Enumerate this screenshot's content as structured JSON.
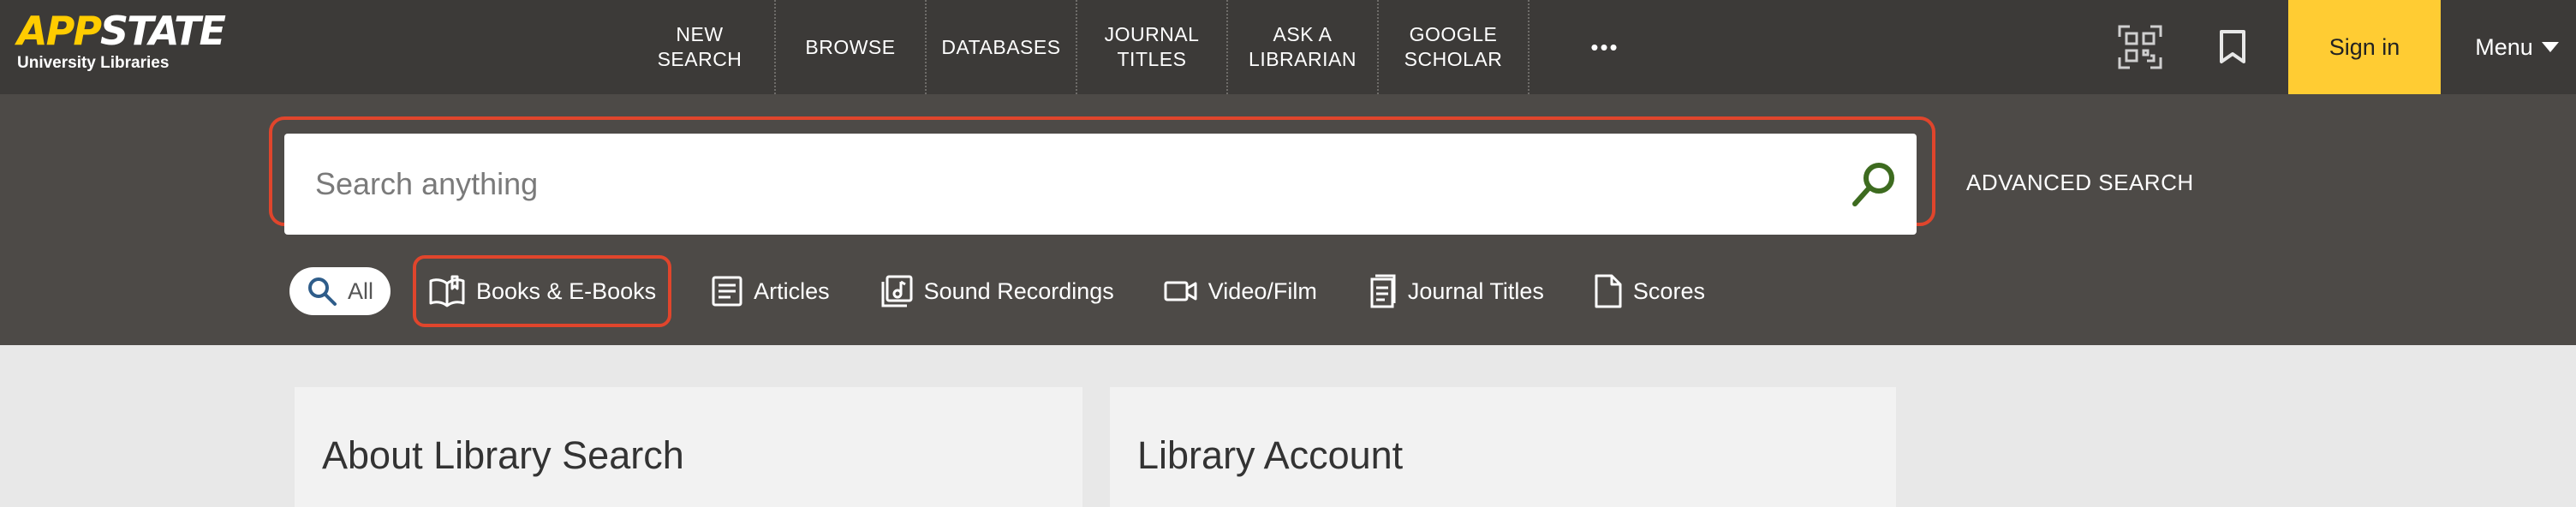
{
  "header": {
    "logo": {
      "app": "APP",
      "state": "STATE",
      "subtitle": "University Libraries"
    },
    "nav": [
      {
        "label": "NEW\nSEARCH",
        "name": "nav-new-search"
      },
      {
        "label": "BROWSE",
        "name": "nav-browse"
      },
      {
        "label": "DATABASES",
        "name": "nav-databases"
      },
      {
        "label": "JOURNAL\nTITLES",
        "name": "nav-journal-titles"
      },
      {
        "label": "ASK A\nLIBRARIAN",
        "name": "nav-ask-a-librarian"
      },
      {
        "label": "GOOGLE\nSCHOLAR",
        "name": "nav-google-scholar"
      },
      {
        "label": "•••",
        "name": "nav-more"
      }
    ],
    "qr_icon": "qr-code-icon",
    "bookmark_icon": "bookmark-icon",
    "signin_label": "Sign in",
    "menu_label": "Menu"
  },
  "search": {
    "placeholder": "Search anything",
    "value": "",
    "advanced_label": "ADVANCED SEARCH",
    "types": [
      {
        "label": "All",
        "icon": "search-icon"
      },
      {
        "label": "Books & E-Books",
        "icon": "open-book-icon"
      },
      {
        "label": "Articles",
        "icon": "article-icon"
      },
      {
        "label": "Sound Recordings",
        "icon": "music-note-icon"
      },
      {
        "label": "Video/Film",
        "icon": "video-camera-icon"
      },
      {
        "label": "Journal Titles",
        "icon": "journal-icon"
      },
      {
        "label": "Scores",
        "icon": "document-icon"
      }
    ]
  },
  "cards": [
    {
      "title": "About Library Search"
    },
    {
      "title": "Library Account"
    }
  ],
  "colors": {
    "topbar": "#3c3a38",
    "search_band": "#4d4a47",
    "brand_yellow": "#ffcc00",
    "highlight_outline": "#e0452c",
    "search_icon_green": "#3d6b1f"
  }
}
